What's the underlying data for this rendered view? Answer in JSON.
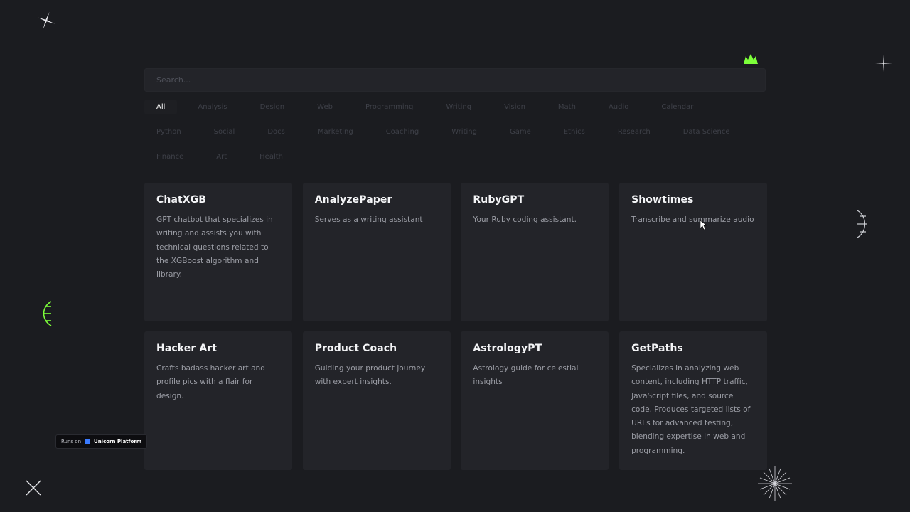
{
  "search": {
    "placeholder": "Search..."
  },
  "filters": [
    {
      "label": "All",
      "active": true
    },
    {
      "label": "Analysis",
      "active": false
    },
    {
      "label": "Design",
      "active": false
    },
    {
      "label": "Web",
      "active": false
    },
    {
      "label": "Programming",
      "active": false
    },
    {
      "label": "Writing",
      "active": false
    },
    {
      "label": "Vision",
      "active": false
    },
    {
      "label": "Math",
      "active": false
    },
    {
      "label": "Audio",
      "active": false
    },
    {
      "label": "Calendar",
      "active": false
    },
    {
      "label": "Python",
      "active": false
    },
    {
      "label": "Social",
      "active": false
    },
    {
      "label": "Docs",
      "active": false
    },
    {
      "label": "Marketing",
      "active": false
    },
    {
      "label": "Coaching",
      "active": false
    },
    {
      "label": "Writing",
      "active": false
    },
    {
      "label": "Game",
      "active": false
    },
    {
      "label": "Ethics",
      "active": false
    },
    {
      "label": "Research",
      "active": false
    },
    {
      "label": "Data Science",
      "active": false
    },
    {
      "label": "Finance",
      "active": false
    },
    {
      "label": "Art",
      "active": false
    },
    {
      "label": "Health",
      "active": false
    }
  ],
  "cards": [
    {
      "title": "ChatXGB",
      "description": "GPT chatbot that specializes in writing and assists you with technical questions related to the XGBoost algorithm and library."
    },
    {
      "title": "AnalyzePaper",
      "description": "Serves as a writing assistant"
    },
    {
      "title": "RubyGPT",
      "description": "Your Ruby coding assistant."
    },
    {
      "title": "Showtimes",
      "description": "Transcribe and summarize audio"
    },
    {
      "title": "Hacker Art",
      "description": "Crafts badass hacker art and profile pics with a flair for design."
    },
    {
      "title": "Product Coach",
      "description": "Guiding your product journey with expert insights."
    },
    {
      "title": "AstrologyPT",
      "description": "Astrology guide for celestial insights"
    },
    {
      "title": "GetPaths",
      "description": "Specializes in analyzing web content, including HTTP traffic, JavaScript files, and source code. Produces targeted lists of URLs for advanced testing, blending expertise in web and programming."
    }
  ],
  "badge": {
    "prefix": "Runs on",
    "brand": "Unicorn Platform"
  },
  "colors": {
    "background": "#1b1c20",
    "card": "#232429",
    "accent_green": "#7dff3a"
  }
}
